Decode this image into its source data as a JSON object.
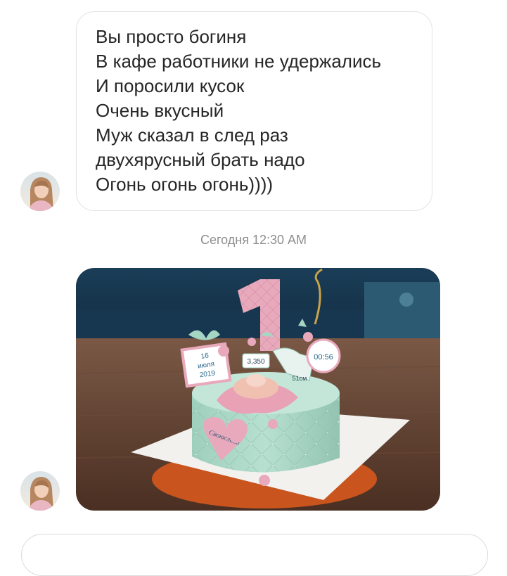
{
  "thread": {
    "incoming_message": {
      "lines": [
        "Вы просто богиня",
        "В кафе работники не удержались",
        "И поросили кусок",
        "Очень вкусный",
        "Муж сказал в след раз",
        "двухярусный брать надо",
        "Огонь огонь огонь))))"
      ]
    },
    "timestamp": "Сегодня 12:30 AM",
    "photo_message": {
      "topper_number": "1",
      "card_day": "16",
      "card_month": "июля",
      "card_year": "2019",
      "weight_label": "3,350",
      "length_label": "51см",
      "time_label": "00:56",
      "heart_name": "Своюслава"
    }
  },
  "colors": {
    "bubble_border": "#e3e3e3",
    "message_text": "#262626",
    "timestamp_text": "#8e8e8e",
    "cake_mint": "#a9d8c6",
    "cake_pink": "#e8a4b8",
    "wall_navy": "#17374f",
    "table_wood": "#5a3a2a"
  },
  "icons": {
    "sender_avatar": "profile-photo-woman"
  }
}
